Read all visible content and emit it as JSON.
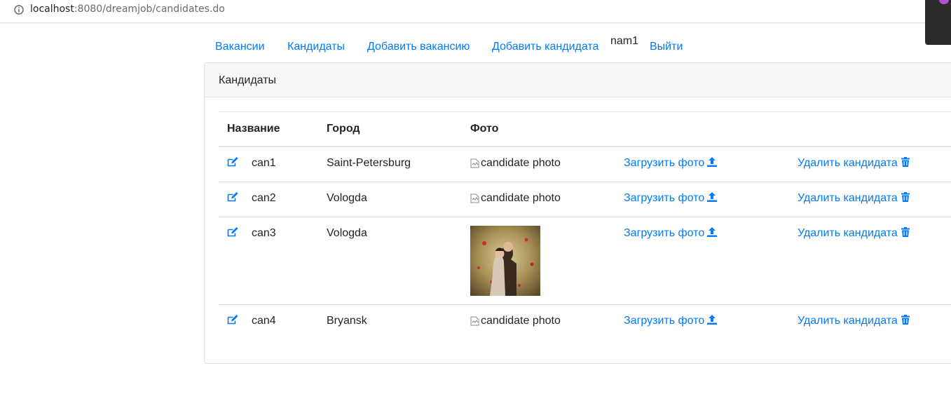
{
  "browser": {
    "url_host": "localhost",
    "url_path": ":8080/dreamjob/candidates.do"
  },
  "nav": {
    "vacancies": "Вакансии",
    "candidates": "Кандидаты",
    "add_vacancy": "Добавить вакансию",
    "add_candidate": "Добавить кандидата",
    "user": "nam1",
    "logout": "Выйти"
  },
  "card": {
    "title": "Кандидаты",
    "columns": {
      "name": "Название",
      "city": "Город",
      "photo": "Фото"
    },
    "rows": [
      {
        "name": "can1",
        "city": "Saint-Petersburg",
        "photo_alt": "candidate photo",
        "upload": "Загрузить фото",
        "delete": "Удалить кандидата"
      },
      {
        "name": "can2",
        "city": "Vologda",
        "photo_alt": "candidate photo",
        "upload": "Загрузить фото",
        "delete": "Удалить кандидата"
      },
      {
        "name": "can3",
        "city": "Vologda",
        "photo_alt": "",
        "upload": "Загрузить фото",
        "delete": "Удалить кандидата"
      },
      {
        "name": "can4",
        "city": "Bryansk",
        "photo_alt": "candidate photo",
        "upload": "Загрузить фото",
        "delete": "Удалить кандидата"
      }
    ]
  },
  "icons": {
    "edit": "edit-icon",
    "upload": "upload-icon",
    "delete": "trash-icon",
    "info": "info-icon",
    "broken_image": "broken-image-icon"
  },
  "colors": {
    "link": "#007bff",
    "header_bg": "#f7f7f7",
    "border": "#dee2e6"
  }
}
